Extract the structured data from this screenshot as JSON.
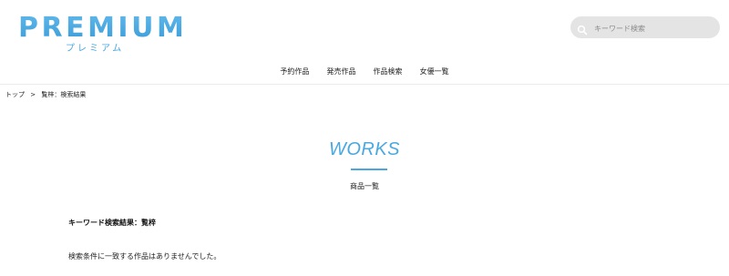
{
  "logo": {
    "text": "PREMIUM",
    "subtext": "プレミアム"
  },
  "search": {
    "placeholder": "キーワード検索",
    "icon": "search-icon"
  },
  "nav": {
    "items": [
      {
        "label": "予約作品"
      },
      {
        "label": "発売作品"
      },
      {
        "label": "作品検索"
      },
      {
        "label": "女優一覧"
      }
    ]
  },
  "breadcrumb": {
    "home": "トップ",
    "separator": ">",
    "current": "覧梓：検索結果"
  },
  "works": {
    "title": "WORKS",
    "subtitle": "商品一覧",
    "result_heading": "キーワード検索結果：覧梓",
    "result_message": "検索条件に一致する作品はありませんでした。"
  },
  "colors": {
    "accent": "#4aa8e0",
    "search_bg": "#e4e4e4"
  }
}
